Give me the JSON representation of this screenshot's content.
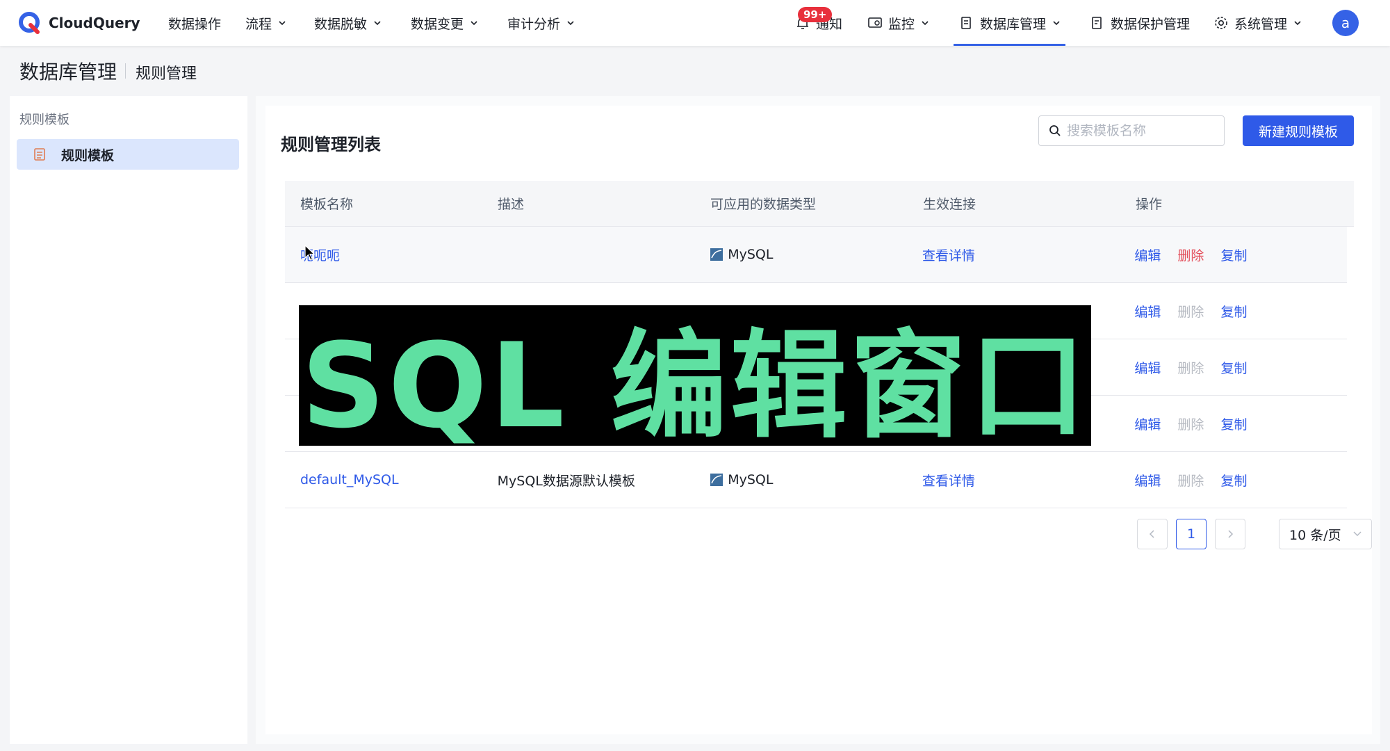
{
  "app": {
    "name": "CloudQuery"
  },
  "nav": {
    "items": [
      {
        "label": "数据操作",
        "has_dropdown": false
      },
      {
        "label": "流程",
        "has_dropdown": true
      },
      {
        "label": "数据脱敏",
        "has_dropdown": true
      },
      {
        "label": "数据变更",
        "has_dropdown": true
      },
      {
        "label": "审计分析",
        "has_dropdown": true
      }
    ],
    "notify": {
      "label": "通知",
      "badge": "99+",
      "icon": "bell-icon"
    },
    "monitor": {
      "label": "监控",
      "icon": "monitor-icon"
    },
    "db_manage": {
      "label": "数据库管理",
      "icon": "database-doc-icon",
      "active": true
    },
    "data_protect": {
      "label": "数据保护管理",
      "icon": "shield-doc-icon"
    },
    "system": {
      "label": "系统管理",
      "icon": "gear-icon"
    },
    "avatar": "a"
  },
  "breadcrumb": {
    "main": "数据库管理",
    "sub": "规则管理"
  },
  "sidebar": {
    "title": "规则模板",
    "items": [
      {
        "label": "规则模板",
        "icon": "template-icon",
        "selected": true
      }
    ]
  },
  "panel": {
    "title": "规则管理列表",
    "search_placeholder": "搜索模板名称",
    "new_button": "新建规则模板"
  },
  "table": {
    "headers": [
      "模板名称",
      "描述",
      "可应用的数据类型",
      "生效连接",
      "操作"
    ],
    "rows": [
      {
        "name": "呃呃呃",
        "desc": "",
        "db_type": "MySQL",
        "detail": "查看详情",
        "edit": "编辑",
        "delete": "删除",
        "copy": "复制",
        "delete_enabled": true
      },
      {
        "name": "",
        "desc": "",
        "db_type": "",
        "detail": "",
        "edit": "编辑",
        "delete": "删除",
        "copy": "复制",
        "delete_enabled": false
      },
      {
        "name": "",
        "desc": "",
        "db_type": "",
        "detail": "",
        "edit": "编辑",
        "delete": "删除",
        "copy": "复制",
        "delete_enabled": false
      },
      {
        "name": "",
        "desc": "",
        "db_type": "",
        "detail": "",
        "edit": "编辑",
        "delete": "删除",
        "copy": "复制",
        "delete_enabled": false
      },
      {
        "name": "default_MySQL",
        "desc": "MySQL数据源默认模板",
        "db_type": "MySQL",
        "detail": "查看详情",
        "edit": "编辑",
        "delete": "删除",
        "copy": "复制",
        "delete_enabled": false
      }
    ]
  },
  "pagination": {
    "current": "1",
    "page_size": "10 条/页"
  },
  "overlay": {
    "text": "SQL 编辑窗口"
  },
  "colors": {
    "primary": "#2f5ae8",
    "danger": "#e34d59",
    "banner_text": "#5fe0a2"
  }
}
